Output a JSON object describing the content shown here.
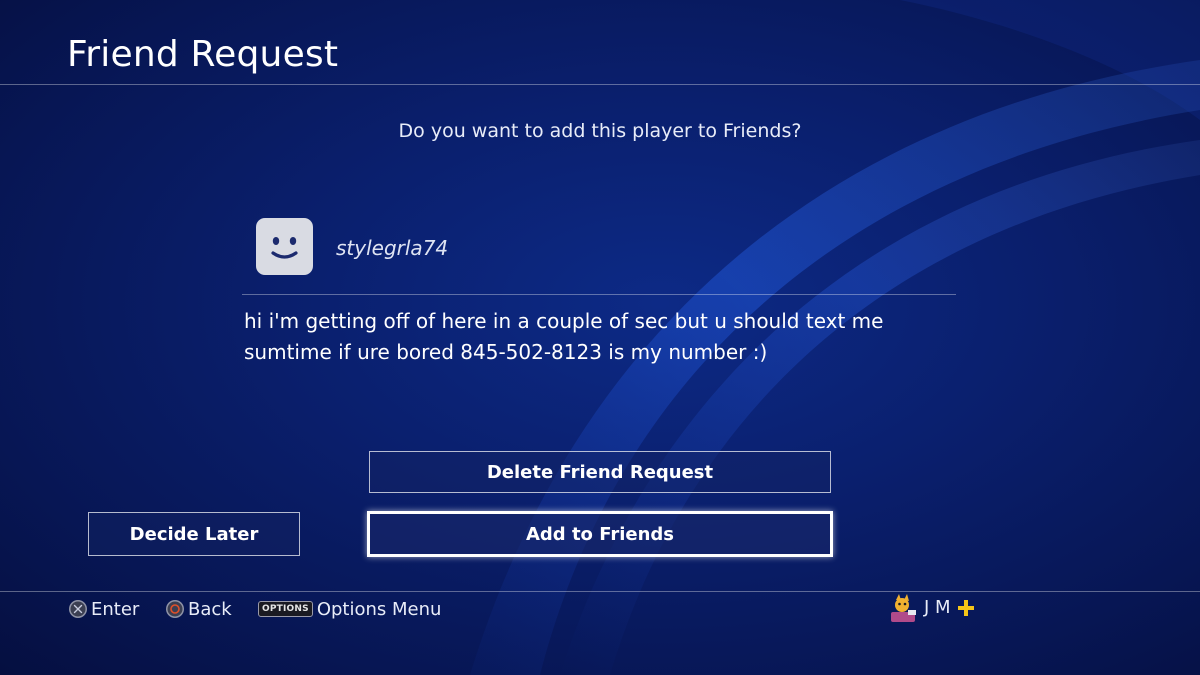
{
  "header": {
    "title": "Friend Request"
  },
  "dialog": {
    "question": "Do you want to add this player to Friends?",
    "username": "stylegrla74",
    "message": "hi i'm getting off of here in a couple of sec but u should text me sumtime if ure bored 845-502-8123 is my number :)"
  },
  "buttons": {
    "delete_label": "Delete Friend Request",
    "decide_later_label": "Decide Later",
    "add_label": "Add to Friends"
  },
  "footer": {
    "enter_label": "Enter",
    "back_label": "Back",
    "options_tag": "OPTIONS",
    "options_label": "Options Menu",
    "user_label": "J M"
  },
  "icons": {
    "cross": "cross-button-icon",
    "circle": "circle-button-icon",
    "avatar": "smiley-avatar-icon",
    "plus": "ps-plus-icon"
  },
  "colors": {
    "background": "#0a1f6d",
    "accent_plus": "#f5c518",
    "circle_button": "#e0502a"
  }
}
